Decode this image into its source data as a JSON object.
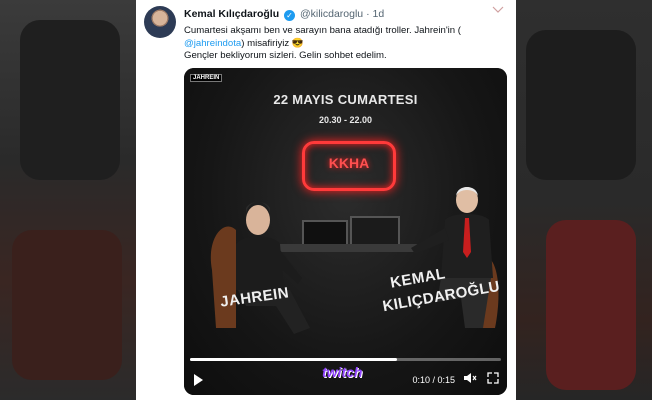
{
  "tweet": {
    "author_name": "Kemal Kılıçdaroğlu",
    "handle": "@kilicdaroglu",
    "time": "1d",
    "separator": "·",
    "text_line1": "Cumartesi akşamı ben ve sarayın bana atadığı troller. Jahrein'in (",
    "mention": "@jahreindota",
    "text_line2": ") misafiriyiz 😎",
    "text_line3": "Gençler bekliyorum sizleri. Gelin sohbet edelim.",
    "verified_icon": "verified-check-icon",
    "menu_icon": "chevron-down-icon"
  },
  "video": {
    "channel_tag": "JAHREIN",
    "date_text": "22 MAYIS CUMARTESI",
    "time_text": "20.30 - 22.00",
    "neon_sign": "KKHA",
    "guest_left_name": "JAHREIN",
    "guest_right_name_line1": "KEMAL",
    "guest_right_name_line2": "KILIÇDAROĞLU",
    "platform_logo": "twitch",
    "timecode": "0:10 / 0:15",
    "progress": 0.6667,
    "play_icon": "play-icon",
    "volume_icon": "volume-mute-icon",
    "fullscreen_icon": "fullscreen-icon"
  },
  "colors": {
    "neon_red": "#ff3a3a",
    "twitch_purple": "#9146ff",
    "link_blue": "#1d9bf0"
  }
}
